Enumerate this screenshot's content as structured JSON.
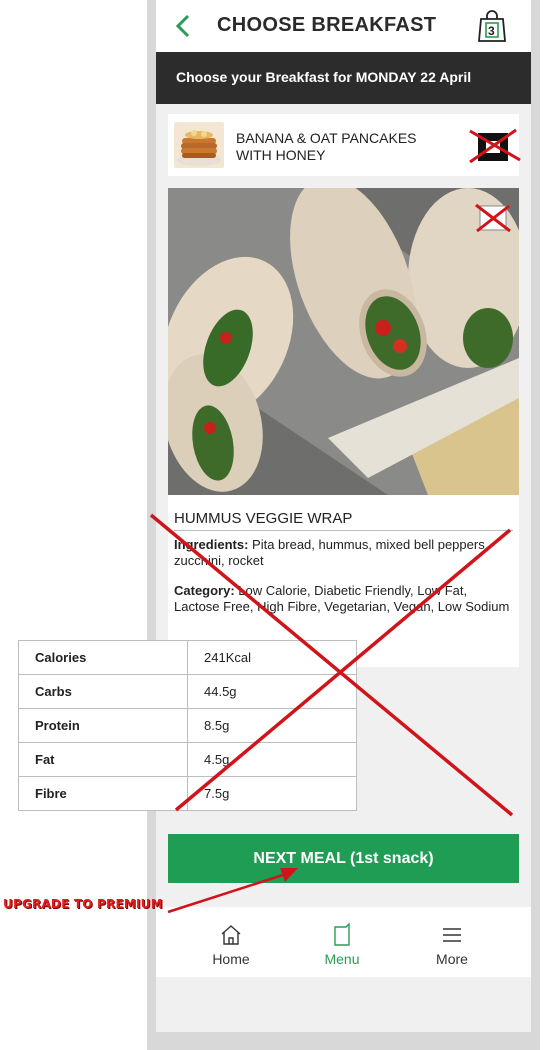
{
  "header": {
    "title": "CHOOSE BREAKFAST",
    "bag_count": "3",
    "back_icon": "chevron-left-icon",
    "bag_icon": "shopping-bag-icon"
  },
  "day_banner": "Choose your Breakfast for MONDAY  22 April",
  "selected_meal": {
    "title": "BANANA & OAT PANCAKES WITH HONEY"
  },
  "meal": {
    "name": "HUMMUS VEGGIE WRAP",
    "ingredients_label": "Ingredients:",
    "ingredients": " Pita bread, hummus, mixed bell peppers, zucchini, rocket",
    "category_label": "Category:",
    "category": " Low Calorie, Diabetic Friendly, Low Fat, Lactose Free, High Fibre, Vegetarian, Vegan, Low Sodium"
  },
  "nutrition": [
    {
      "label": "Calories",
      "value": "241Kcal"
    },
    {
      "label": "Carbs",
      "value": "44.5g"
    },
    {
      "label": "Protein",
      "value": "8.5g"
    },
    {
      "label": "Fat",
      "value": "4.5g"
    },
    {
      "label": "Fibre",
      "value": "7.5g"
    }
  ],
  "next_button": "NEXT MEAL (1st snack)",
  "nav": [
    {
      "label": "Home",
      "icon": "home-icon"
    },
    {
      "label": "Menu",
      "icon": "menu-page-icon",
      "active": true
    },
    {
      "label": "More",
      "icon": "hamburger-icon"
    }
  ],
  "annotation": {
    "text": "UPGRADE TO PREMIUM",
    "color": "#e02020"
  },
  "colors": {
    "accent": "#1f9d55",
    "dark_bar": "#2c2c2c",
    "strike": "#d0141a"
  }
}
